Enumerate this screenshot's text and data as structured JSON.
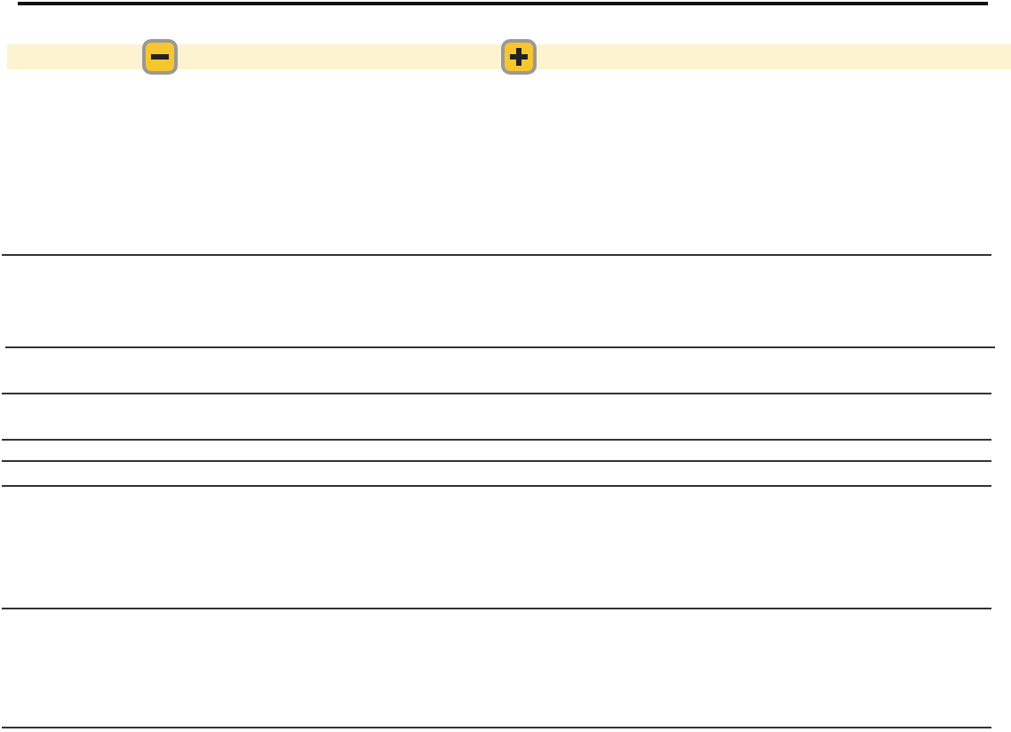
{
  "zoom_bar": {
    "buttons": [
      {
        "kind": "minus"
      },
      {
        "kind": "plus"
      }
    ]
  }
}
